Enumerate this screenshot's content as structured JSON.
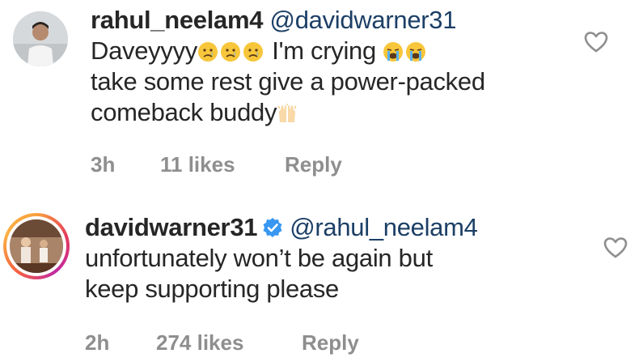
{
  "comments": [
    {
      "username": "rahul_neelam4",
      "mention": "@davidwarner31",
      "line1_text": "Daveyyyy",
      "line1_mid": " I'm crying ",
      "line2": "take some rest give a power-packed",
      "line3": "comeback buddy",
      "time": "3h",
      "likes": "11 likes",
      "reply": "Reply",
      "emojis": [
        "crying-face",
        "crying-face",
        "crying-face",
        "loudly-crying-face",
        "loudly-crying-face",
        "raising-hands"
      ]
    },
    {
      "username": "davidwarner31",
      "verified": true,
      "mention": "@rahul_neelam4",
      "line1": "unfortunately won’t be again but",
      "line2": "keep supporting please",
      "time": "2h",
      "likes": "274 likes",
      "reply": "Reply"
    }
  ],
  "colors": {
    "text": "#262626",
    "mention": "#1c3f66",
    "meta": "#8e8e8e",
    "verified": "#3897f0",
    "story_ring": "#e1306c"
  }
}
